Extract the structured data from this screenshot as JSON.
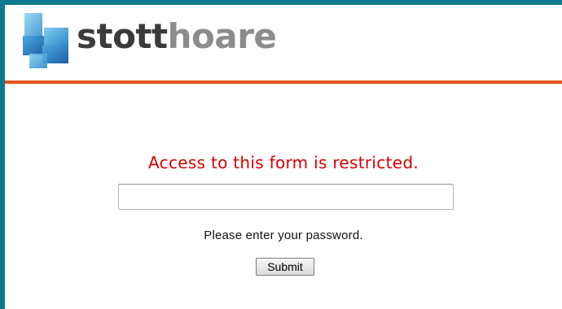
{
  "brand": {
    "logo_dark": "stott",
    "logo_light": "hoare",
    "logo_icon": "stacked-squares-logo-icon",
    "accent_color": "#e0551b",
    "frame_color": "#0b7a8c"
  },
  "form": {
    "restricted_message": "Access to this form is restricted.",
    "restricted_color": "#d40000",
    "password_value": "",
    "password_placeholder": "",
    "prompt": "Please enter your password.",
    "submit_label": "Submit"
  }
}
